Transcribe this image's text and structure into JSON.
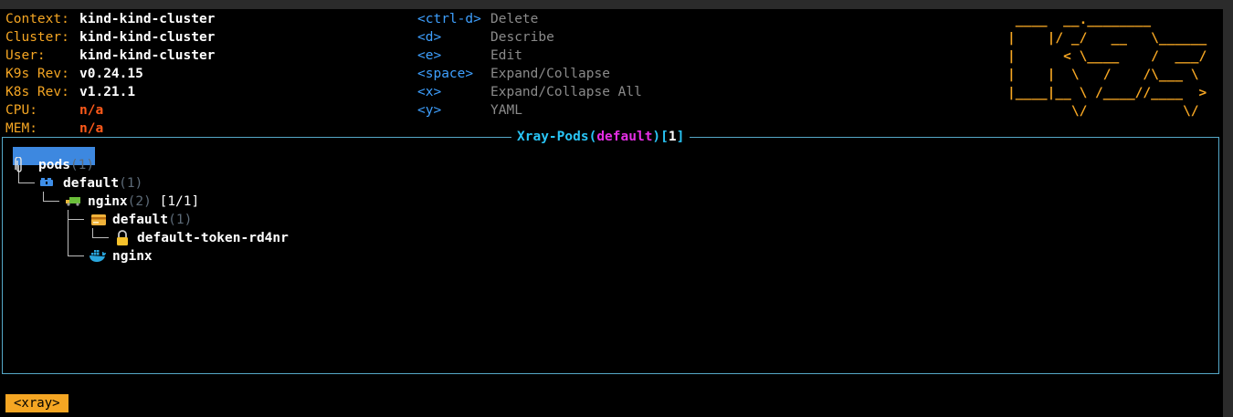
{
  "header": {
    "info": [
      {
        "label": "Context:",
        "value": "kind-kind-cluster"
      },
      {
        "label": "Cluster:",
        "value": "kind-kind-cluster"
      },
      {
        "label": "User:",
        "value": "kind-kind-cluster"
      },
      {
        "label": "K9s Rev:",
        "value": "v0.24.15"
      },
      {
        "label": "K8s Rev:",
        "value": "v1.21.1"
      },
      {
        "label": "CPU:",
        "value": "n/a"
      },
      {
        "label": "MEM:",
        "value": "n/a"
      }
    ],
    "shortcuts": [
      {
        "key": "<ctrl-d>",
        "action": "Delete"
      },
      {
        "key": "<d>",
        "action": "Describe"
      },
      {
        "key": "<e>",
        "action": "Edit"
      },
      {
        "key": "<space>",
        "action": "Expand/Collapse"
      },
      {
        "key": "<x>",
        "action": "Expand/Collapse All"
      },
      {
        "key": "<y>",
        "action": "YAML"
      }
    ],
    "logo_ascii": " ____  __.________\n|    |/ _/   __   \\______\n|      < \\____    /  ___/\n|    |  \\   /    /\\___ \\\n|____|__ \\ /____//____  >\n        \\/            \\/"
  },
  "xray": {
    "title_prefix": "Xray-Pods(",
    "namespace": "default",
    "title_mid": ")[",
    "count": "1",
    "title_suffix": "]",
    "tree": [
      {
        "name": "pods",
        "count": "(1)",
        "icon": "paperclip-icon"
      },
      {
        "name": "default",
        "count": "(1)",
        "icon": "namespace-icon"
      },
      {
        "name": "nginx",
        "count": "(2)",
        "extra": "[1/1]",
        "icon": "pod-truck-icon"
      },
      {
        "name": "default",
        "count": "(1)",
        "icon": "service-account-card-icon"
      },
      {
        "name": "default-token-rd4nr",
        "icon": "lock-icon"
      },
      {
        "name": "nginx",
        "icon": "container-docker-icon"
      }
    ]
  },
  "crumbs": [
    "<xray>"
  ],
  "colors": {
    "accent": "#f5a623",
    "key": "#3ea0ff",
    "title": "#29c5f6",
    "namespace": "#e52ee5",
    "selection": "#3d88e0",
    "na": "#ff5a1a"
  }
}
